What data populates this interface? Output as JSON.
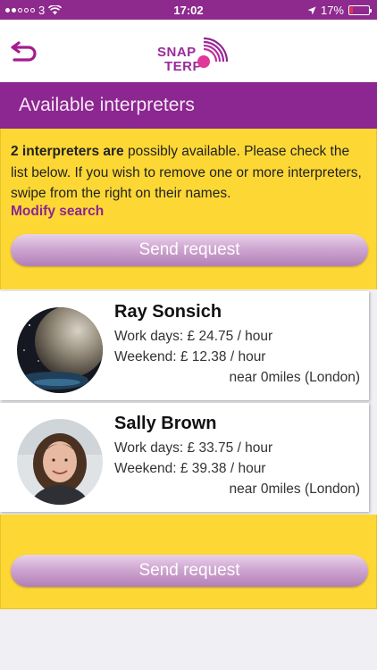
{
  "status_bar": {
    "carrier": "3",
    "time": "17:02",
    "battery": "17%",
    "battery_level": 0.17,
    "signal_bars_filled": 2,
    "signal_bars_total": 5
  },
  "nav": {
    "logo_line1": "SNAP",
    "logo_line2": "TERP",
    "back_icon": "back-arrow-icon"
  },
  "title": "Available interpreters",
  "info": {
    "count_bold": "2 interpreters are",
    "message": " possibly available. Please check the list below. If you wish to remove one or more interpreters, swipe from the right on their names.",
    "modify_link": "Modify search"
  },
  "send_request_label": "Send request",
  "interpreters": [
    {
      "name": "Ray Sonsich",
      "work_days": "Work days: £ 24.75 / hour",
      "weekend": "Weekend: £ 12.38 / hour",
      "distance": "near 0miles (London)"
    },
    {
      "name": "Sally Brown",
      "work_days": "Work days: £ 33.75 / hour",
      "weekend": "Weekend: £ 39.38 / hour",
      "distance": "near 0miles (London)"
    }
  ],
  "colors": {
    "brand_purple": "#8c2690",
    "info_yellow": "#fdd835"
  }
}
